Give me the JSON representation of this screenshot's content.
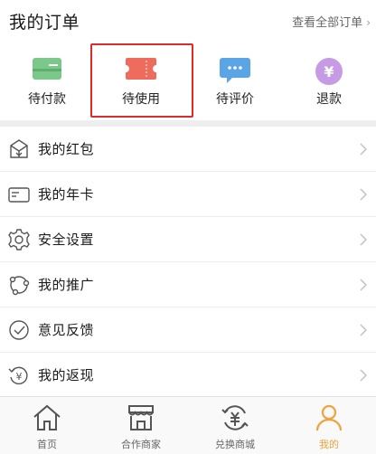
{
  "orders": {
    "title": "我的订单",
    "view_all": "查看全部订单",
    "tiles": [
      {
        "label": "待付款",
        "icon": "card-icon",
        "color": "#7bc88a"
      },
      {
        "label": "待使用",
        "icon": "ticket-icon",
        "color": "#ef6b5e"
      },
      {
        "label": "待评价",
        "icon": "chat-bubble-icon",
        "color": "#5ba4e6"
      },
      {
        "label": "退款",
        "icon": "yen-refund-icon",
        "color": "#c79ae6"
      }
    ]
  },
  "menu": [
    {
      "label": "我的红包",
      "icon": "red-packet-icon"
    },
    {
      "label": "我的年卡",
      "icon": "card-outline-icon"
    },
    {
      "label": "安全设置",
      "icon": "gear-icon"
    },
    {
      "label": "我的推广",
      "icon": "share-icon"
    },
    {
      "label": "意见反馈",
      "icon": "feedback-check-icon"
    },
    {
      "label": "我的返现",
      "icon": "cashback-icon"
    }
  ],
  "tabbar": [
    {
      "label": "首页",
      "icon": "home-icon"
    },
    {
      "label": "合作商家",
      "icon": "store-icon"
    },
    {
      "label": "兑换商城",
      "icon": "exchange-icon"
    },
    {
      "label": "我的",
      "icon": "person-icon",
      "active": true
    }
  ],
  "colors": {
    "accent": "#f0a23c",
    "highlight": "#e02a2a",
    "divider": "#eeeeee"
  }
}
